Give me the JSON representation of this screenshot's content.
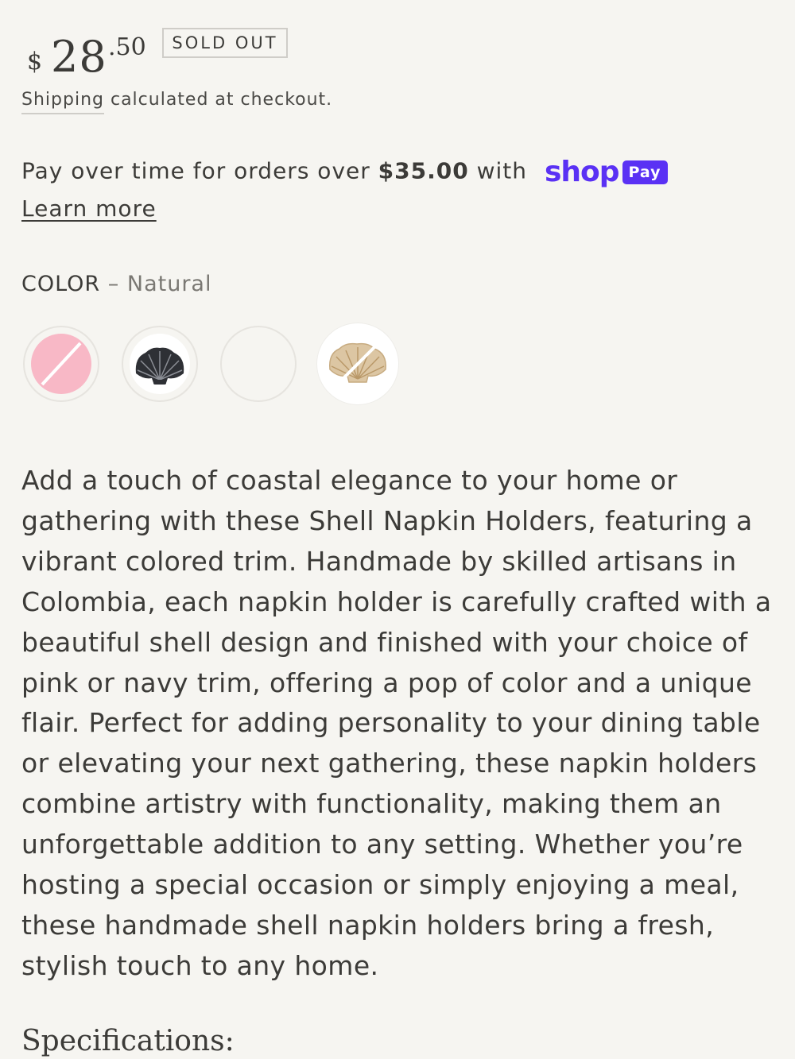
{
  "price": {
    "currency": "$",
    "dollars": "28",
    "cents": ".50",
    "badge": "SOLD OUT"
  },
  "shipping": {
    "link_text": "Shipping",
    "rest_text": " calculated at checkout."
  },
  "installments": {
    "prefix": "Pay over time for orders over ",
    "threshold": "$35.00",
    "suffix": " with",
    "shop_word": "shop",
    "pay_word": "Pay",
    "learn_more": "Learn more",
    "brand_color": "#5a31f4"
  },
  "color_option": {
    "label": "COLOR",
    "separator": " – ",
    "selected": "Natural",
    "swatches": [
      {
        "name": "pink",
        "available": false,
        "color": "#f8b8c6"
      },
      {
        "name": "navy",
        "available": true,
        "color": "#2e3035"
      },
      {
        "name": "white",
        "available": true,
        "color": "#f6f5f1"
      },
      {
        "name": "natural",
        "available": false,
        "color": "#d8c3a2",
        "selected": true
      }
    ]
  },
  "description": "Add a touch of coastal elegance to your home or gathering with these Shell Napkin Holders, featuring a vibrant colored trim. Handmade by skilled artisans in Colombia, each napkin holder is carefully crafted with a beautiful shell design and finished with your choice of pink or navy trim, offering a pop of color and a unique flair. Perfect for adding personality to your dining table or elevating your next gathering, these napkin holders combine artistry with functionality, making them an unforgettable addition to any setting. Whether you’re hosting a special occasion or simply enjoying a meal, these handmade shell napkin holders bring a fresh, stylish touch to any home.",
  "specifications_heading": "Specifications:"
}
